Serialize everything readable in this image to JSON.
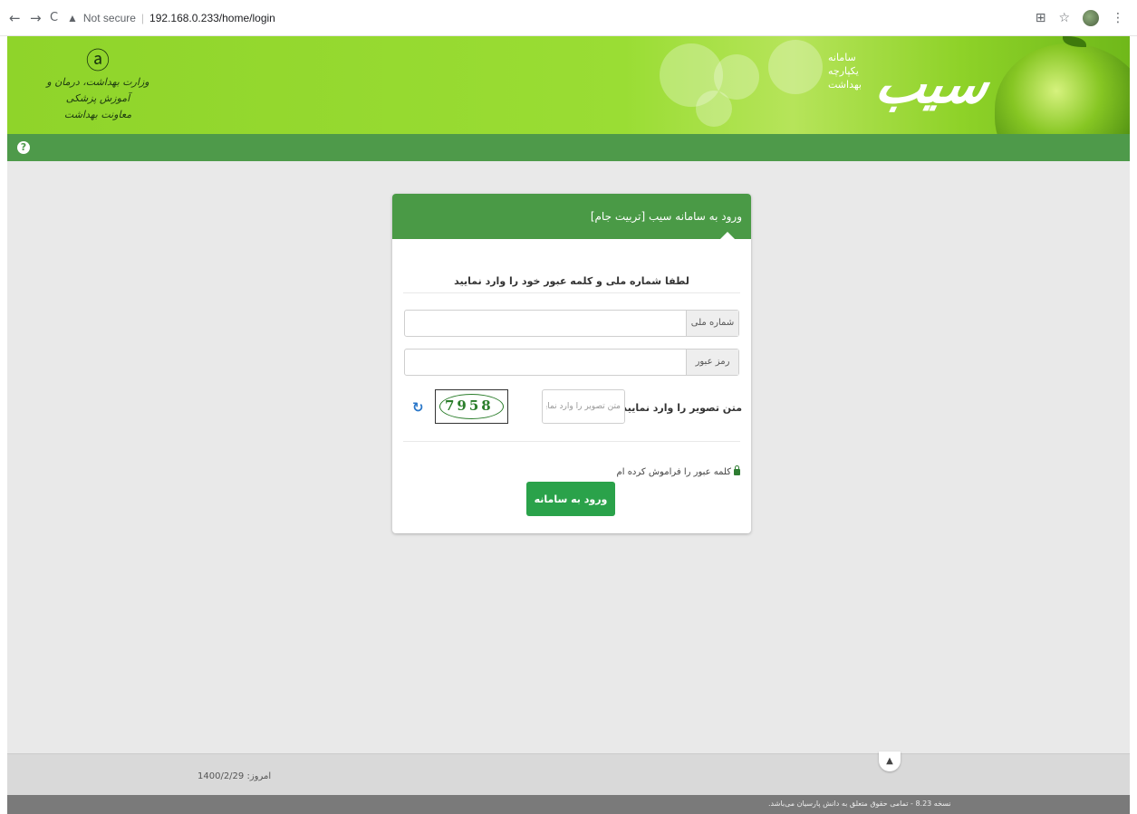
{
  "browser": {
    "back_icon": "←",
    "forward_icon": "→",
    "reload_icon": "C",
    "warning_icon": "▲",
    "security_label": "Not secure",
    "url": "192.168.0.233/home/login",
    "star_icon": "☆",
    "menu_icon": "⋮",
    "translate_icon": "⊞"
  },
  "header": {
    "ministry_emblem": "ⓐ",
    "ministry_line1": "وزارت بهداشت، درمان و آموزش پزشکی",
    "ministry_line2": "معاونت بهداشت",
    "sib_line1": "سامانه",
    "sib_line2": "یکپارچه",
    "sib_line3": "بهداشت",
    "sib_logo": "سیب"
  },
  "toolbar": {
    "help_icon": "?"
  },
  "login": {
    "title": "ورود به سامانه سیب [تربیت جام]",
    "prompt": "لطفا شماره ملی و کلمه عبور خود را وارد نمایید",
    "national_id_label": "شماره ملی",
    "national_id_value": "",
    "password_label": "رمز عبور",
    "password_value": "",
    "captcha_label": "متن تصویر را وارد نمایید",
    "captcha_placeholder": "متن تصویر را وارد نمایید",
    "captcha_text": "7958",
    "refresh_icon": "↻",
    "forgot_label": "کلمه عبور را فراموش کرده ام",
    "submit_label": "ورود به سامانه"
  },
  "footer": {
    "date_label": "امروز: 1400/2/29",
    "scroll_top_icon": "▲",
    "copyright": "نسخه 8.23 - تمامی حقوق متعلق به دانش پارسیان می‌باشد."
  }
}
